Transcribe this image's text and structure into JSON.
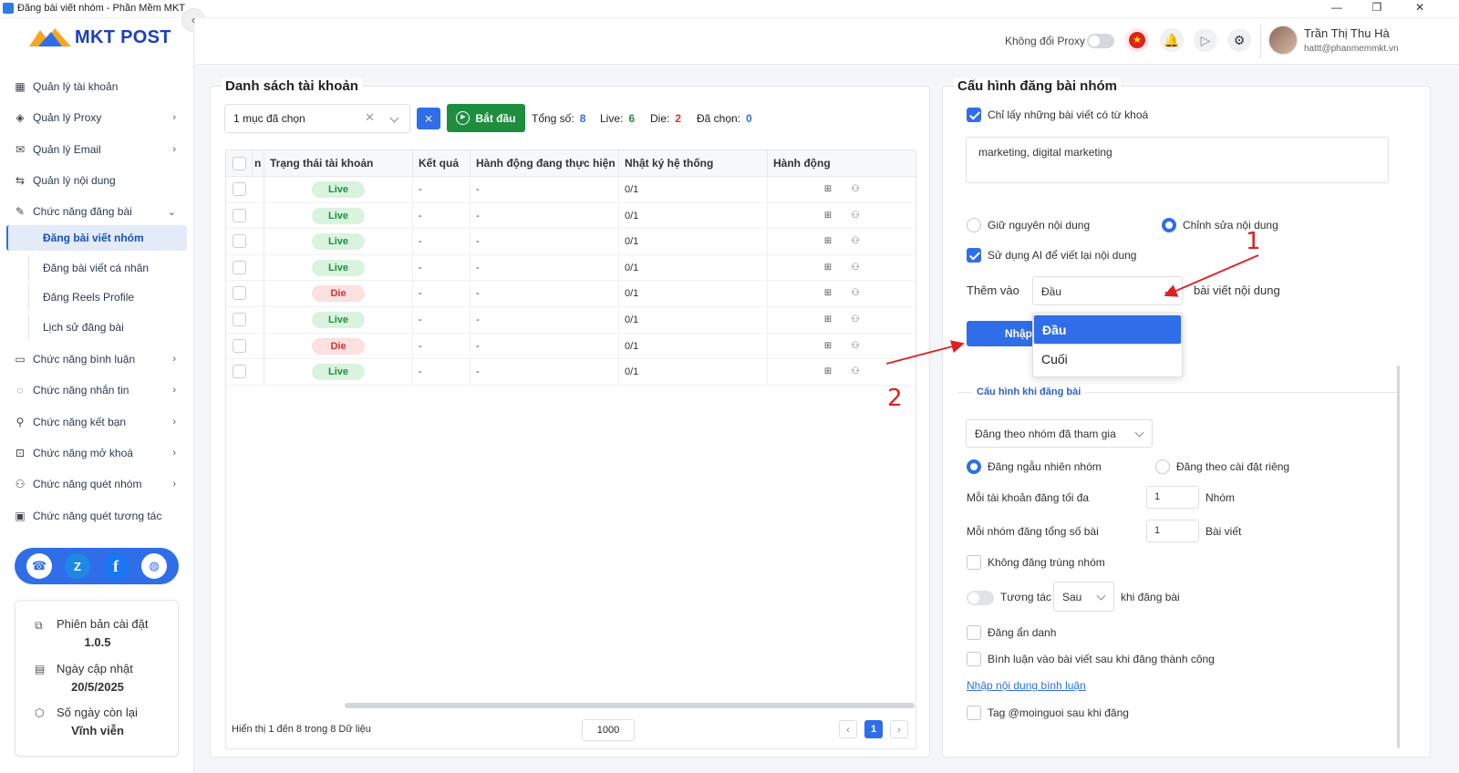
{
  "window": {
    "title": "Đăng bài viết nhóm - Phần Mềm MKT",
    "min": "—",
    "max": "❐",
    "close": "✕"
  },
  "brand": {
    "logo_text": "MKT POST",
    "accent": "#2f6ee8",
    "collapse_icon": "‹"
  },
  "sidebar": {
    "items": [
      {
        "icon": "grid-icon",
        "glyph": "▦",
        "label": "Quản lý tài khoản",
        "chevron": ""
      },
      {
        "icon": "layers-icon",
        "glyph": "◈",
        "label": "Quản lý Proxy",
        "chevron": "›"
      },
      {
        "icon": "mail-icon",
        "glyph": "✉",
        "label": "Quản lý Email",
        "chevron": "›"
      },
      {
        "icon": "content-icon",
        "glyph": "⇆",
        "label": "Quản lý nội dung",
        "chevron": ""
      },
      {
        "icon": "post-icon",
        "glyph": "✎",
        "label": "Chức năng đăng bài",
        "chevron": "⌄"
      }
    ],
    "subitems": [
      {
        "label": "Đăng bài viết nhóm",
        "active": true
      },
      {
        "label": "Đăng bài viết cá nhân",
        "active": false
      },
      {
        "label": "Đăng Reels Profile",
        "active": false
      },
      {
        "label": "Lịch sử đăng bài",
        "active": false
      }
    ],
    "items2": [
      {
        "icon": "comment-icon",
        "glyph": "▭",
        "label": "Chức năng bình luận",
        "chevron": "›"
      },
      {
        "icon": "chat-icon",
        "glyph": "◌",
        "label": "Chức năng nhắn tin",
        "chevron": "›"
      },
      {
        "icon": "add-friend-icon",
        "glyph": "⚲",
        "label": "Chức năng kết bạn",
        "chevron": "›"
      },
      {
        "icon": "lock-icon",
        "glyph": "⊡",
        "label": "Chức năng mở khoá",
        "chevron": "›"
      },
      {
        "icon": "group-scan-icon",
        "glyph": "⚇",
        "label": "Chức năng quét nhóm",
        "chevron": "›"
      },
      {
        "icon": "interaction-icon",
        "glyph": "▣",
        "label": "Chức năng quét tương tác",
        "chevron": ""
      }
    ],
    "social": [
      {
        "icon": "support-icon",
        "glyph": "☎"
      },
      {
        "icon": "zalo-icon",
        "glyph": "Z"
      },
      {
        "icon": "facebook-icon",
        "glyph": "f"
      },
      {
        "icon": "globe-icon",
        "glyph": "🌐"
      }
    ],
    "info": {
      "version_label": "Phiên bản cài đặt",
      "version": "1.0.5",
      "updated_label": "Ngày cập nhật",
      "updated": "20/5/2025",
      "days_label": "Số ngày còn lại",
      "days": "Vĩnh viễn"
    }
  },
  "header": {
    "proxy_label": "Không đổi Proxy",
    "user_name": "Trần Thị Thu Hà",
    "user_email": "hattt@phanmemmkt.vn"
  },
  "accounts": {
    "title": "Danh sách tài khoản",
    "select_value": "1 mục đã chọn",
    "start_label": "Bắt đầu",
    "stats": {
      "total_label": "Tổng số:",
      "total": "8",
      "live_label": "Live:",
      "live": "6",
      "die_label": "Die:",
      "die": "2",
      "selected_label": "Đã chọn:",
      "selected": "0"
    },
    "columns": [
      "n",
      "Trạng thái tài khoản",
      "Kết quả",
      "Hành động đang thực hiện",
      "Nhật ký hệ thống",
      "Hành động"
    ],
    "rows": [
      {
        "status": "Live",
        "result": "-",
        "action": "-",
        "log": "0/1"
      },
      {
        "status": "Live",
        "result": "-",
        "action": "-",
        "log": "0/1"
      },
      {
        "status": "Live",
        "result": "-",
        "action": "-",
        "log": "0/1"
      },
      {
        "status": "Live",
        "result": "-",
        "action": "-",
        "log": "0/1"
      },
      {
        "status": "Die",
        "result": "-",
        "action": "-",
        "log": "0/1"
      },
      {
        "status": "Live",
        "result": "-",
        "action": "-",
        "log": "0/1"
      },
      {
        "status": "Die",
        "result": "-",
        "action": "-",
        "log": "0/1"
      },
      {
        "status": "Live",
        "result": "-",
        "action": "-",
        "log": "0/1"
      }
    ],
    "showing": "Hiển thị 1 đến 8 trong 8 Dữ liệu",
    "page_size": "1000",
    "page": "1"
  },
  "config": {
    "title": "Cấu hình đăng bài nhóm",
    "keyword_only": "Chỉ lấy những bài viết có từ khoá",
    "keywords": "marketing, digital marketing",
    "keep_content": "Giữ nguyên nội dung",
    "edit_content": "Chỉnh sửa nội dung",
    "use_ai": "Sử dụng AI để viết lại nội dung",
    "add_to": "Thêm vào",
    "position_value": "Đầu",
    "after_text": "bài viết nội dung",
    "import_label": "Nhập",
    "dropdown_options": [
      "Đầu",
      "Cuối"
    ],
    "post_config_title": "Cấu hình khi đăng bài",
    "group_mode": "Đăng theo nhóm đã tham gia",
    "random_group": "Đăng ngẫu nhiên nhóm",
    "custom_setting": "Đăng theo cài đặt riêng",
    "max_per_account_label": "Mỗi tài khoản đăng tối đa",
    "max_per_account": "1",
    "groups_unit": "Nhóm",
    "posts_per_group_label": "Mỗi nhóm đăng tổng số bài",
    "posts_per_group": "1",
    "posts_unit": "Bài viết",
    "no_duplicate": "Không đăng trùng nhóm",
    "interact": "Tương tác",
    "interact_when": "Sau",
    "interact_suffix": "khi đăng bài",
    "anonymous": "Đăng ẩn danh",
    "comment_after": "Bình luận vào bài viết sau khi đăng thành công",
    "comment_link": "Nhập nội dung bình luận",
    "tag_everyone": "Tag @moinguoi sau khi đăng"
  },
  "annotations": {
    "one": "1",
    "two": "2"
  }
}
